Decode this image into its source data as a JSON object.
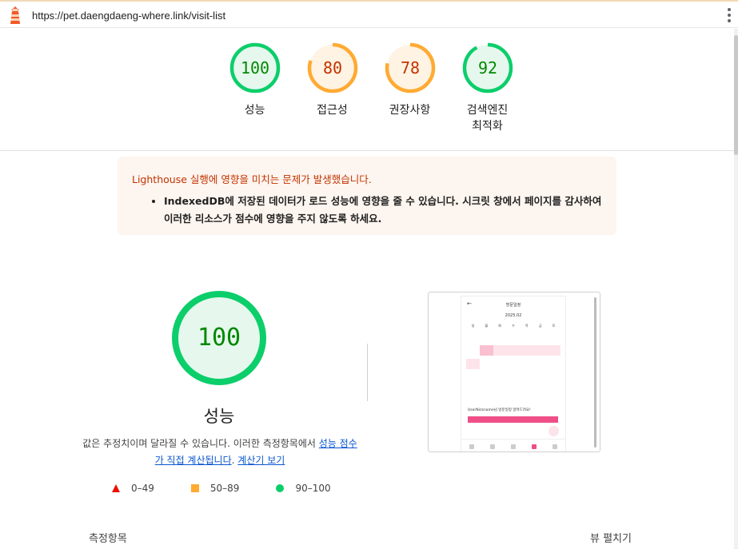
{
  "url": "https://pet.daengdaeng-where.link/visit-list",
  "gauges": [
    {
      "score": "100",
      "label": "성능",
      "color": "#0cce6b",
      "fill": "#e6f8ee",
      "text": "#008800",
      "value": 1.0
    },
    {
      "score": "80",
      "label": "접근성",
      "color": "#ffaa33",
      "fill": "#fff3e3",
      "text": "#c33300",
      "value": 0.8
    },
    {
      "score": "78",
      "label": "권장사항",
      "color": "#ffaa33",
      "fill": "#fff3e3",
      "text": "#c33300",
      "value": 0.78
    },
    {
      "score": "92",
      "label": "검색엔진\n최적화",
      "color": "#0cce6b",
      "fill": "#e6f8ee",
      "text": "#008800",
      "value": 0.92
    }
  ],
  "warning": {
    "title": "Lighthouse 실행에 영향을 미치는 문제가 발생했습니다.",
    "item": "IndexedDB에 저장된 데이터가 로드 성능에 영향을 줄 수 있습니다. 시크릿 창에서 페이지를 감사하여 이러한 리소스가 점수에 영향을 주지 않도록 하세요."
  },
  "performance": {
    "score": "100",
    "title": "성능",
    "desc_prefix": "값은 추정치이며 달라질 수 있습니다. 이러한 측정항목에서 ",
    "desc_link": "성능 점수가 직접 계산됩니다",
    "desc_sep": ". ",
    "calc_link": "계산기 보기"
  },
  "legend": [
    {
      "shape": "triangle",
      "range": "0–49"
    },
    {
      "shape": "square",
      "range": "50–89"
    },
    {
      "shape": "circle",
      "range": "90–100"
    }
  ],
  "metrics_label": "측정항목",
  "expand_view": "뷰 펼치기",
  "thumbnail": {
    "header": "방문일정",
    "month": "2025.02",
    "weekdays": [
      "일",
      "월",
      "화",
      "수",
      "목",
      "금",
      "토"
    ],
    "section": "UserNickname님 방문일정 알려드려요!"
  },
  "colors": {
    "pass": "#0cce6b",
    "average": "#ffaa33",
    "fail": "#eb0f00"
  }
}
